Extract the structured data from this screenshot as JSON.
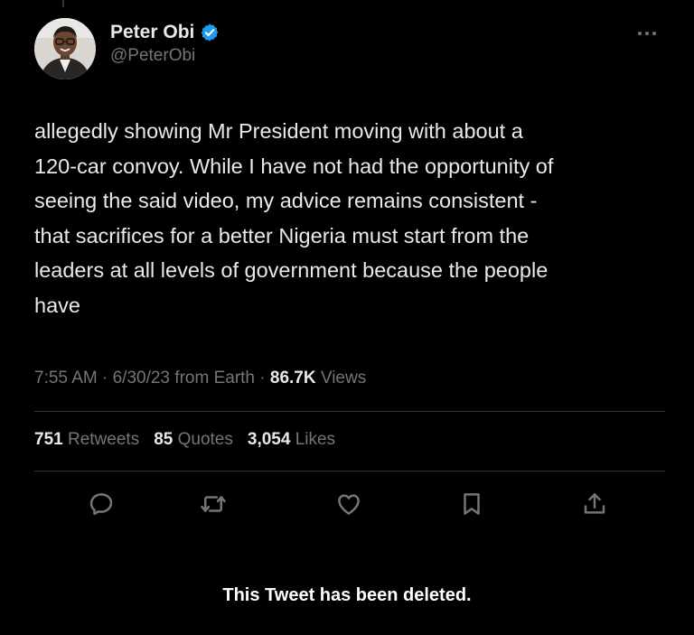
{
  "tweet": {
    "author": {
      "display_name": "Peter Obi",
      "handle": "@PeterObi",
      "verified": true,
      "verified_color": "#1d9bf0"
    },
    "text": "allegedly showing Mr President moving with about a\n120-car convoy. While I have not had the opportunity of\nseeing the said video, my advice remains consistent -\nthat sacrifices for a better Nigeria must start from the\nleaders at all levels of government because the people\nhave",
    "time": "7:55 AM",
    "date": "6/30/23",
    "source": "from Earth",
    "views_count": "86.7K",
    "views_label": "Views",
    "stats": {
      "retweets_count": "751",
      "retweets_label": "Retweets",
      "quotes_count": "85",
      "quotes_label": "Quotes",
      "likes_count": "3,054",
      "likes_label": "Likes"
    },
    "actions": [
      "reply-icon",
      "retweet-icon",
      "like-icon",
      "bookmark-icon",
      "share-icon"
    ]
  },
  "notice": {
    "deleted_text": "This Tweet has been deleted."
  },
  "colors": {
    "background": "#000000",
    "primary_text": "#e7e9ea",
    "secondary_text": "#71767b",
    "divider": "#2f3336"
  }
}
